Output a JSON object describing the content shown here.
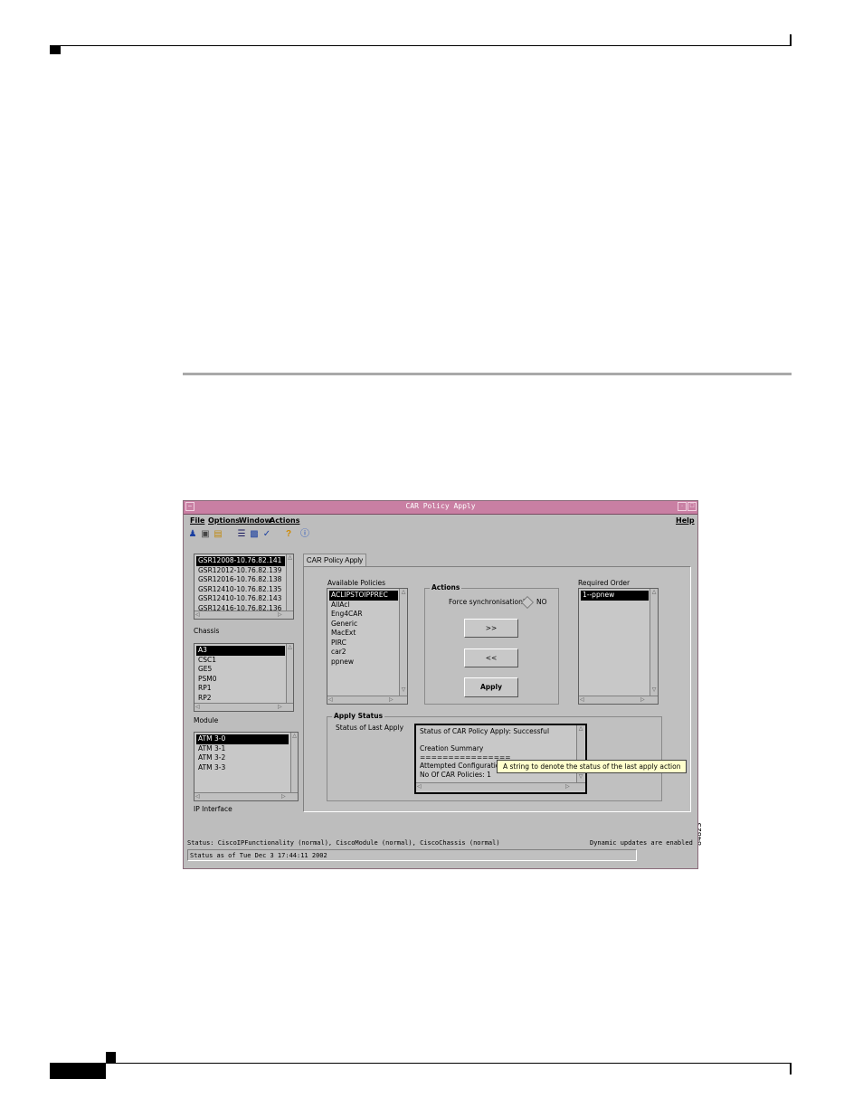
{
  "window": {
    "title": "CAR Policy Apply",
    "menus": [
      "File",
      "Options",
      "Window",
      "Actions"
    ],
    "help_menu": "Help",
    "toolbar_icons": [
      "users-icon",
      "devices-icon",
      "folder-icon",
      "list-icon",
      "chart-icon",
      "check-icon",
      "help-icon",
      "info-icon"
    ]
  },
  "left_pane": {
    "chassis_list": [
      "GSR12008-10.76.82.141",
      "GSR12012-10.76.82.139",
      "GSR12016-10.76.82.138",
      "GSR12410-10.76.82.135",
      "GSR12410-10.76.82.143",
      "GSR12416-10.76.82.136"
    ],
    "chassis_selected": 0,
    "chassis_label": "Chassis",
    "module_list": [
      "A3",
      "CSC1",
      "GE5",
      "PSM0",
      "RP1",
      "RP2"
    ],
    "module_selected": 0,
    "module_label": "Module",
    "interface_list": [
      "ATM 3-0",
      "ATM 3-1",
      "ATM 3-2",
      "ATM 3-3"
    ],
    "interface_selected": 0,
    "interface_label": "IP Interface"
  },
  "tab": {
    "label": "CAR Policy Apply"
  },
  "available": {
    "label": "Available Policies",
    "items": [
      "ACLIPSTOIPPREC",
      "AllAcl",
      "Eng4CAR",
      "Generic",
      "MacExt",
      "PIRC",
      "car2",
      "ppnew"
    ],
    "selected": 0
  },
  "actions": {
    "label": "Actions",
    "force_sync_label": "Force synchronisation?",
    "force_sync_value": "NO",
    "add_button": ">>",
    "remove_button": "<<",
    "apply_button": "Apply"
  },
  "required": {
    "label": "Required Order",
    "items": [
      "1--ppnew"
    ],
    "selected": 0
  },
  "apply_status": {
    "label": "Apply Status",
    "status_label": "Status of Last Apply",
    "lines": [
      "Status of CAR Policy Apply:  Successful",
      "",
      "Creation Summary",
      "================",
      "Attempted Configuration:",
      "No Of CAR Policies: 1"
    ],
    "tooltip": "A string to denote the status of the last apply action"
  },
  "statusbar": {
    "status_text": "Status: CiscoIPFunctionality (normal), CiscoModule (normal), CiscoChassis (normal)",
    "dynamic_text": "Dynamic updates are enabled",
    "status_as_of": "Status as of Tue Dec  3 17:44:11 2002"
  },
  "figure_id": "84823"
}
